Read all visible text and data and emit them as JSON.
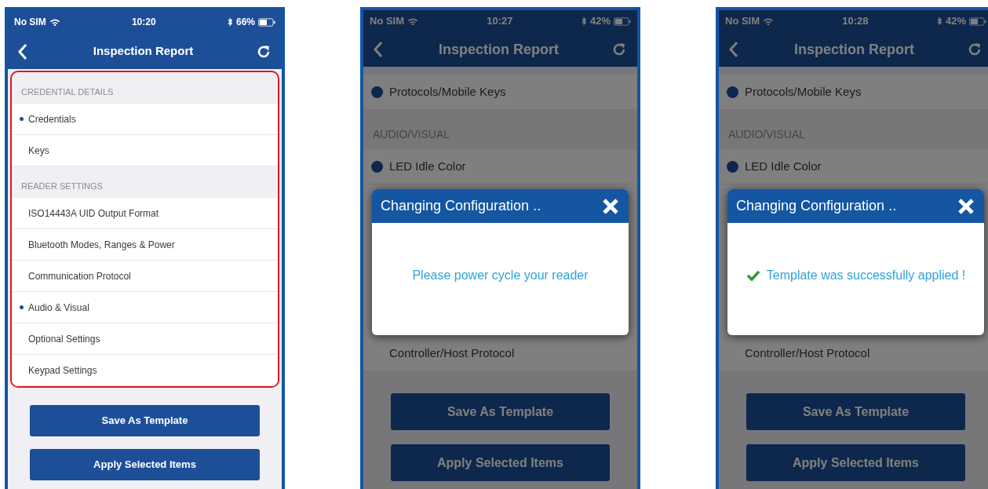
{
  "phones": [
    {
      "status": {
        "carrier": "No SIM",
        "time": "10:20",
        "battery": "66%"
      },
      "title": "Inspection Report",
      "highlighted": true,
      "dimmed": false,
      "sections": [
        {
          "header": "CREDENTIAL DETAILS",
          "items": [
            {
              "label": "Credentials",
              "marked": true
            },
            {
              "label": "Keys",
              "marked": false
            }
          ]
        },
        {
          "header": "READER SETTINGS",
          "items": [
            {
              "label": "ISO14443A UID Output Format",
              "marked": false
            },
            {
              "label": "Bluetooth Modes, Ranges & Power",
              "marked": false
            },
            {
              "label": "Communication Protocol",
              "marked": false
            },
            {
              "label": "Audio & Visual",
              "marked": true
            },
            {
              "label": "Optional Settings",
              "marked": false
            },
            {
              "label": "Keypad Settings",
              "marked": false
            }
          ]
        }
      ],
      "buttons": [
        "Save As Template",
        "Apply Selected Items"
      ]
    },
    {
      "status": {
        "carrier": "No SIM",
        "time": "10:27",
        "battery": "42%"
      },
      "title": "Inspection Report",
      "highlighted": false,
      "dimmed": true,
      "sections": [
        {
          "items": [
            {
              "label": "Protocols/Mobile Keys",
              "marked": true
            }
          ]
        },
        {
          "header": "AUDIO/VISUAL",
          "items": [
            {
              "label": "LED Idle Color",
              "marked": true
            }
          ]
        }
      ],
      "sections_below_dialog": [
        {
          "items": [
            {
              "label": "Controller/Host Protocol",
              "marked": false
            }
          ]
        }
      ],
      "dialog": {
        "title": "Changing Configuration ..",
        "kind": "info",
        "message": "Please power cycle your reader"
      },
      "buttons": [
        "Save As Template",
        "Apply Selected Items"
      ]
    },
    {
      "status": {
        "carrier": "No SIM",
        "time": "10:28",
        "battery": "42%"
      },
      "title": "Inspection Report",
      "highlighted": false,
      "dimmed": true,
      "sections": [
        {
          "items": [
            {
              "label": "Protocols/Mobile Keys",
              "marked": true
            }
          ]
        },
        {
          "header": "AUDIO/VISUAL",
          "items": [
            {
              "label": "LED Idle Color",
              "marked": true
            }
          ]
        }
      ],
      "sections_below_dialog": [
        {
          "items": [
            {
              "label": "Controller/Host Protocol",
              "marked": false
            }
          ]
        }
      ],
      "dialog": {
        "title": "Changing Configuration ..",
        "kind": "success",
        "message": "Template was successfully applied !"
      },
      "buttons": [
        "Save As Template",
        "Apply Selected Items"
      ]
    }
  ]
}
